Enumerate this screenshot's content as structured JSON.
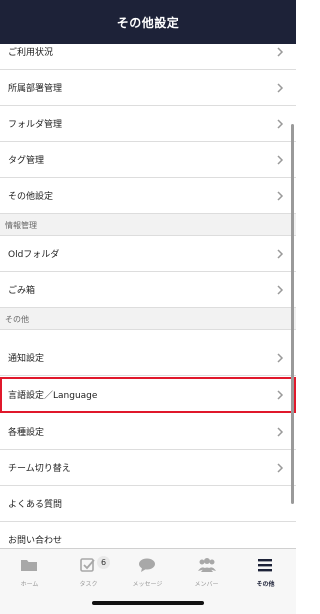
{
  "header": {
    "title": "その他設定"
  },
  "menu_top": [
    {
      "label": "ご利用状況"
    },
    {
      "label": "所属部署管理"
    },
    {
      "label": "フォルダ管理"
    },
    {
      "label": "タグ管理"
    },
    {
      "label": "その他設定"
    }
  ],
  "section_info": {
    "title": "情報管理"
  },
  "menu_info": [
    {
      "label": "Oldフォルダ"
    },
    {
      "label": "ごみ箱"
    }
  ],
  "section_other": {
    "title": "その他"
  },
  "menu_other": [
    {
      "label": "通知設定"
    },
    {
      "label": "言語設定／Language",
      "highlighted": true
    },
    {
      "label": "各種設定"
    },
    {
      "label": "チーム切り替え"
    },
    {
      "label": "よくある質問"
    },
    {
      "label": "お問い合わせ"
    }
  ],
  "tabbar": {
    "tabs": [
      {
        "label": "ホーム",
        "icon": "folder-icon"
      },
      {
        "label": "タスク",
        "icon": "task-checkbox-icon",
        "badge": "6"
      },
      {
        "label": "メッセージ",
        "icon": "chat-bubble-icon"
      },
      {
        "label": "メンバー",
        "icon": "members-icon"
      },
      {
        "label": "その他",
        "icon": "menu-icon",
        "active": true
      }
    ]
  },
  "colors": {
    "header_bg": "#1d2238",
    "highlight_border": "#e0182b",
    "inactive_tab": "#9a9a9a"
  }
}
